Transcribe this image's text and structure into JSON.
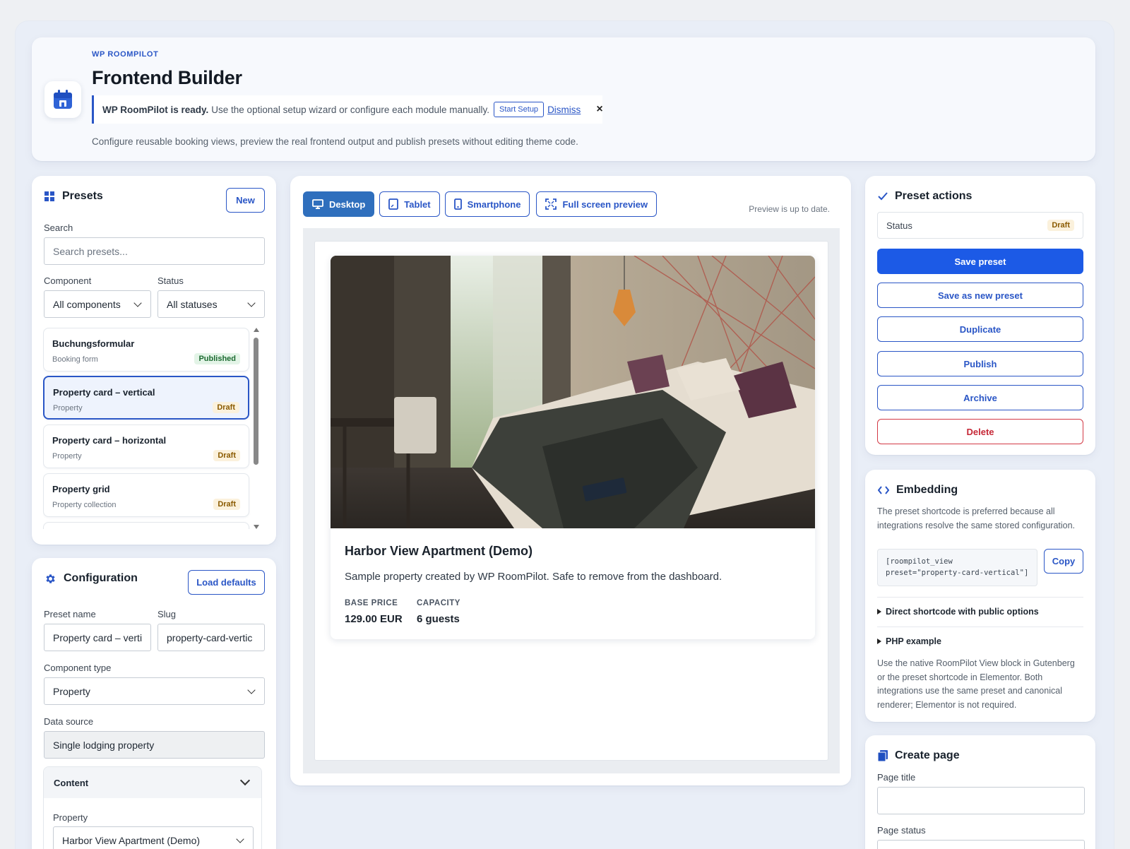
{
  "header": {
    "eyebrow": "WP ROOMPILOT",
    "title": "Frontend Builder",
    "notice_strong": "WP RoomPilot is ready.",
    "notice_text": "Use the optional setup wizard or configure each module manually.",
    "start_setup_label": "Start Setup",
    "dismiss_label": "Dismiss",
    "close_glyph": "×",
    "description": "Configure reusable booking views, preview the real frontend output and publish presets without editing theme code."
  },
  "presets": {
    "title": "Presets",
    "new_label": "New",
    "search_label": "Search",
    "search_placeholder": "Search presets...",
    "component_label": "Component",
    "component_value": "All components",
    "status_label": "Status",
    "status_value": "All statuses",
    "items": [
      {
        "title": "Buchungsformular",
        "subtitle": "Booking form",
        "status": "Published"
      },
      {
        "title": "Property card – vertical",
        "subtitle": "Property",
        "status": "Draft"
      },
      {
        "title": "Property card – horizontal",
        "subtitle": "Property",
        "status": "Draft"
      },
      {
        "title": "Property grid",
        "subtitle": "Property collection",
        "status": "Draft"
      }
    ]
  },
  "configuration": {
    "title": "Configuration",
    "load_defaults_label": "Load defaults",
    "preset_name_label": "Preset name",
    "preset_name_value": "Property card – verti",
    "slug_label": "Slug",
    "slug_value": "property-card-vertic",
    "component_type_label": "Component type",
    "component_type_value": "Property",
    "data_source_label": "Data source",
    "data_source_value": "Single lodging property",
    "content_section_label": "Content",
    "property_label": "Property",
    "property_value": "Harbor View Apartment (Demo)"
  },
  "preview": {
    "tabs": [
      "Desktop",
      "Tablet",
      "Smartphone",
      "Full screen preview"
    ],
    "status_text": "Preview is up to date.",
    "property_name": "Harbor View Apartment (Demo)",
    "property_description": "Sample property created by WP RoomPilot. Safe to remove from the dashboard.",
    "base_price_label": "BASE PRICE",
    "base_price_value": "129.00 EUR",
    "capacity_label": "CAPACITY",
    "capacity_value": "6 guests"
  },
  "actions": {
    "title": "Preset actions",
    "status_label": "Status",
    "status_value": "Draft",
    "save_label": "Save preset",
    "save_new_label": "Save as new preset",
    "duplicate_label": "Duplicate",
    "publish_label": "Publish",
    "archive_label": "Archive",
    "delete_label": "Delete"
  },
  "embedding": {
    "title": "Embedding",
    "intro": "The preset shortcode is preferred because all integrations resolve the same stored configuration.",
    "shortcode": "[roompilot_view preset=\"property-card-vertical\"]",
    "copy_label": "Copy",
    "direct_shortcode_label": "Direct shortcode with public options",
    "php_example_label": "PHP example",
    "note": "Use the native RoomPilot View block in Gutenberg or the preset shortcode in Elementor. Both integrations use the same preset and canonical renderer; Elementor is not required."
  },
  "create_page": {
    "title": "Create page",
    "page_title_label": "Page title",
    "page_title_value": "",
    "page_status_label": "Page status"
  },
  "colors": {
    "accent": "#2a56c6",
    "primary_button": "#1c5ae6",
    "danger": "#c62837",
    "draft_badge": "#8a5a00",
    "published_badge": "#1d6b32"
  }
}
